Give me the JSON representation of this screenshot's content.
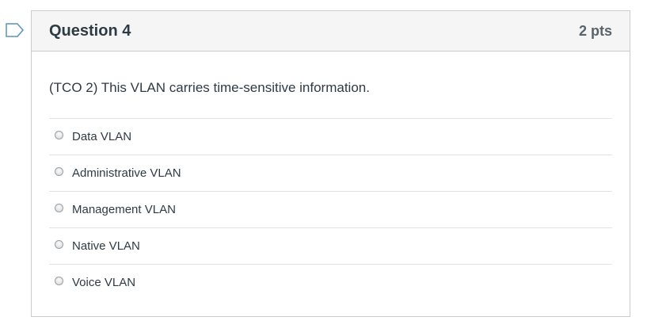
{
  "question": {
    "title": "Question 4",
    "points": "2 pts",
    "text": "(TCO 2) This VLAN carries time-sensitive information.",
    "flag_icon": "flag-outline-icon",
    "answers": [
      {
        "label": "Data VLAN",
        "selected": false
      },
      {
        "label": "Administrative VLAN",
        "selected": false
      },
      {
        "label": "Management VLAN",
        "selected": false
      },
      {
        "label": "Native VLAN",
        "selected": false
      },
      {
        "label": "Voice VLAN",
        "selected": false
      }
    ]
  },
  "colors": {
    "flag": "#5a93b8",
    "header_bg": "#f5f5f5",
    "border": "#c7cdd1",
    "text": "#2d3b45"
  }
}
